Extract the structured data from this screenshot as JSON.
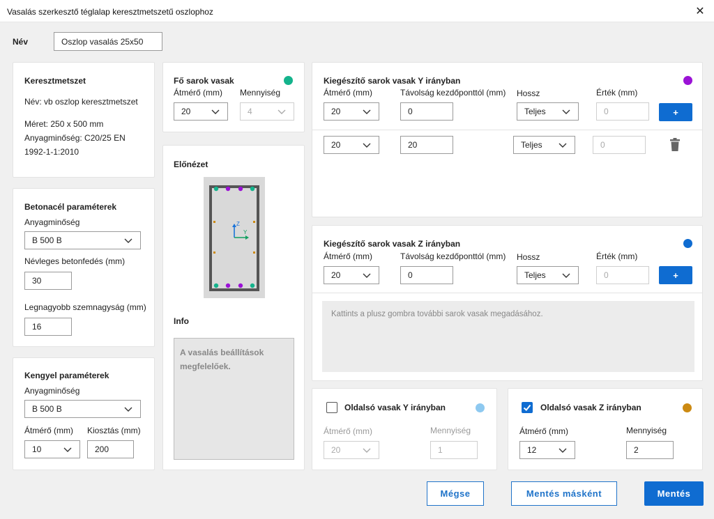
{
  "window": {
    "title": "Vasalás szerkesztő téglalap keresztmetszetű oszlophoz"
  },
  "name": {
    "label": "Név",
    "value": "Oszlop vasalás 25x50"
  },
  "cross_section": {
    "heading": "Keresztmetszet",
    "name_line": "Név: vb oszlop keresztmetszet",
    "size_line": "Méret: 250 x 500 mm",
    "material_line1": "Anyagminőség: C20/25 EN",
    "material_line2": "1992-1-1:2010"
  },
  "rebar_params": {
    "heading": "Betonacél paraméterek",
    "material_label": "Anyagminőség",
    "material_value": "B 500 B",
    "cover_label": "Névleges betonfedés (mm)",
    "cover_value": "30",
    "grain_label": "Legnagyobb szemnagyság (mm)",
    "grain_value": "16"
  },
  "stirrup_params": {
    "heading": "Kengyel paraméterek",
    "material_label": "Anyagminőség",
    "material_value": "B 500 B",
    "diameter_label": "Átmérő (mm)",
    "diameter_value": "10",
    "spacing_label": "Kiosztás (mm)",
    "spacing_value": "200"
  },
  "main_corner": {
    "heading": "Fő sarok vasak",
    "color": "#14b38c",
    "diameter_label": "Átmérő (mm)",
    "diameter_value": "20",
    "quantity_label": "Mennyiség",
    "quantity_value": "4"
  },
  "preview": {
    "heading": "Előnézet",
    "axis_z": "Z",
    "axis_y": "Y",
    "info_heading": "Info",
    "info_text": "A vasalás beállítások megfelelőek."
  },
  "extra_y": {
    "heading": "Kiegészítő sarok vasak Y irányban",
    "color": "#9b12d6",
    "diameter_label": "Átmérő (mm)",
    "distance_label": "Távolság kezdőponttól (mm)",
    "length_label": "Hossz",
    "value_label": "Érték (mm)",
    "add_label": "+",
    "new_row": {
      "diameter": "20",
      "distance": "0",
      "length": "Teljes",
      "value": "0"
    },
    "rows": [
      {
        "diameter": "20",
        "distance": "20",
        "length": "Teljes",
        "value": "0"
      }
    ]
  },
  "extra_z": {
    "heading": "Kiegészítő sarok vasak Z irányban",
    "color": "#0f6cd1",
    "diameter_label": "Átmérő (mm)",
    "distance_label": "Távolság kezdőponttól (mm)",
    "length_label": "Hossz",
    "value_label": "Érték (mm)",
    "add_label": "+",
    "new_row": {
      "diameter": "20",
      "distance": "0",
      "length": "Teljes",
      "value": "0"
    },
    "hint": "Kattints a plusz gombra további sarok vasak megadásához."
  },
  "side_y": {
    "heading": "Oldalsó vasak Y irányban",
    "color": "#8ec9f0",
    "checked": false,
    "diameter_label": "Átmérő (mm)",
    "diameter_value": "20",
    "quantity_label": "Mennyiség",
    "quantity_value": "1"
  },
  "side_z": {
    "heading": "Oldalsó vasak Z irányban",
    "color": "#cc8a12",
    "checked": true,
    "diameter_label": "Átmérő (mm)",
    "diameter_value": "12",
    "quantity_label": "Mennyiség",
    "quantity_value": "2"
  },
  "footer": {
    "cancel_label": "Mégse",
    "save_as_label": "Mentés másként",
    "save_label": "Mentés"
  }
}
